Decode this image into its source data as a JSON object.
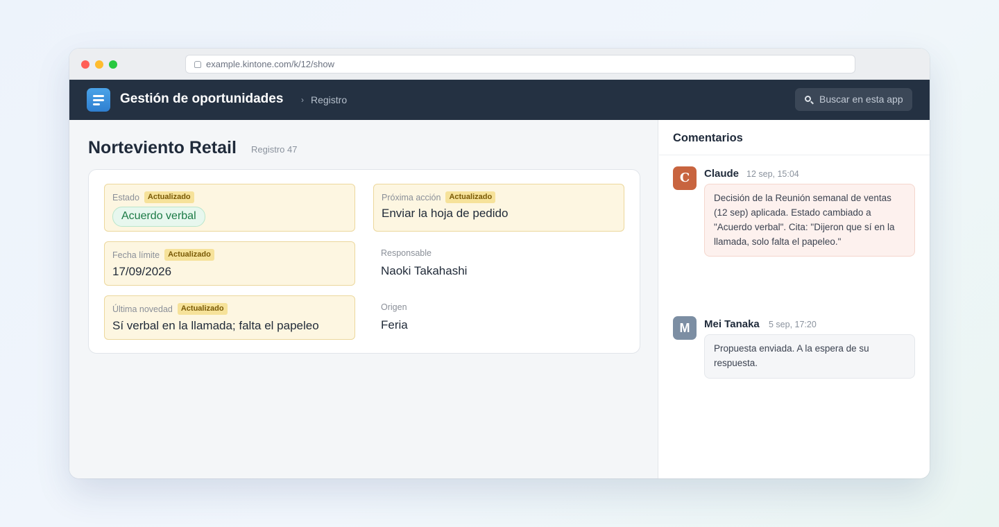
{
  "browser": {
    "url": "example.kintone.com/k/12/show"
  },
  "app": {
    "title": "Gestión de oportunidades",
    "breadcrumb_separator": "›",
    "breadcrumb": "Registro",
    "search_placeholder": "Buscar en esta app"
  },
  "record": {
    "title": "Norteviento Retail",
    "subtitle": "Registro 47",
    "updated_badge": "Actualizado",
    "fields": {
      "estado": {
        "label": "Estado",
        "value": "Acuerdo verbal",
        "updated": true
      },
      "proxima_accion": {
        "label": "Próxima acción",
        "value": "Enviar la hoja de pedido",
        "updated": true
      },
      "fecha_limite": {
        "label": "Fecha límite",
        "value": "17/09/2026",
        "updated": true
      },
      "responsable": {
        "label": "Responsable",
        "value": "Naoki Takahashi",
        "updated": false
      },
      "ultima_novedad": {
        "label": "Última novedad",
        "value": "Sí verbal en la llamada; falta el papeleo",
        "updated": true
      },
      "origen": {
        "label": "Origen",
        "value": "Feria",
        "updated": false
      }
    }
  },
  "comments": {
    "title": "Comentarios",
    "items": [
      {
        "initial": "C",
        "author": "Claude",
        "time": "12 sep, 15:04",
        "text": "Decisión de la Reunión semanal de ventas (12 sep) aplicada. Estado cambiado a \"Acuerdo verbal\". Cita: \"Dijeron que sí en la llamada, solo falta el papeleo.\"",
        "avatar_color": "#c8643f"
      },
      {
        "initial": "M",
        "author": "Mei Tanaka",
        "time": "5 sep, 17:20",
        "text": "Propuesta enviada. A la espera de su respuesta.",
        "avatar_color": "#7c8ea3"
      }
    ]
  },
  "colors": {
    "appbar": "#243142",
    "updated_field_bg": "#fdf6e1",
    "updated_badge_bg": "#f6e29a",
    "status_pill": "#1b7a45",
    "highlight_comment_bg": "#fdf1ee"
  }
}
